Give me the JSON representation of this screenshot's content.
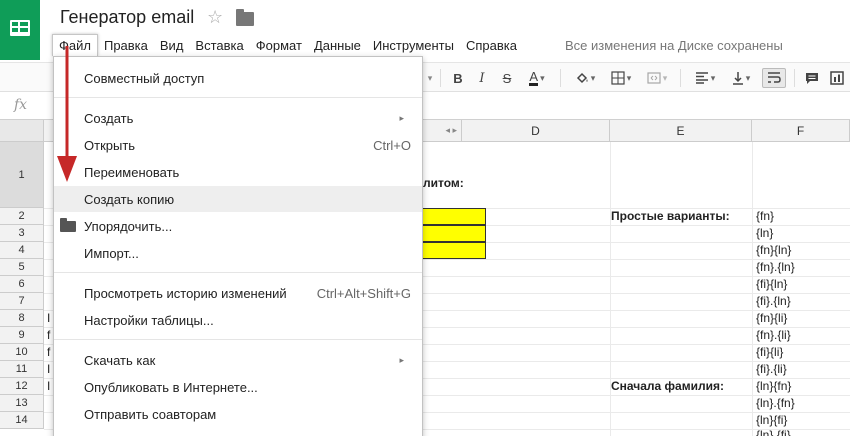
{
  "header": {
    "title": "Генератор email",
    "save_status": "Все изменения на Диске сохранены"
  },
  "menubar": [
    "Файл",
    "Правка",
    "Вид",
    "Вставка",
    "Формат",
    "Данные",
    "Инструменты",
    "Справка"
  ],
  "formula_bar": {
    "fx_label": "fx"
  },
  "columns": [
    "D",
    "E",
    "F"
  ],
  "rows": [
    "1",
    "2",
    "3",
    "4",
    "5",
    "6",
    "7",
    "8",
    "9",
    "10",
    "11",
    "12",
    "13",
    "14"
  ],
  "sheet": {
    "row1_fragment": "литом:",
    "simple_label": "Простые варианты:",
    "surname_first_label": "Сначала фамилия:",
    "left_fragments": [
      "I",
      "f",
      "f",
      "I",
      "I"
    ],
    "f_values": [
      "{fn}",
      "{ln}",
      "{fn}{ln}",
      "{fn}.{ln}",
      "{fi}{ln}",
      "{fi}.{ln}",
      "{fn}{li}",
      "{fn}.{li}",
      "{fi}{li}",
      "{fi}.{li}",
      "{ln}{fn}",
      "{ln}.{fn}",
      "{ln}{fi}",
      "{ln}.{fi}"
    ]
  },
  "file_menu": {
    "items": [
      {
        "label": "Совместный доступ",
        "shortcut": ""
      },
      {
        "label": "Создать",
        "shortcut": "",
        "submenu": true
      },
      {
        "label": "Открыть",
        "shortcut": "Ctrl+O"
      },
      {
        "label": "Переименовать",
        "shortcut": ""
      },
      {
        "label": "Создать копию",
        "shortcut": ""
      },
      {
        "label": "Упорядочить...",
        "shortcut": ""
      },
      {
        "label": "Импорт...",
        "shortcut": ""
      },
      {
        "label": "Просмотреть историю изменений",
        "shortcut": "Ctrl+Alt+Shift+G"
      },
      {
        "label": "Настройки таблицы...",
        "shortcut": ""
      },
      {
        "label": "Скачать как",
        "shortcut": "",
        "submenu": true
      },
      {
        "label": "Опубликовать в Интернете...",
        "shortcut": ""
      },
      {
        "label": "Отправить соавторам",
        "shortcut": ""
      }
    ],
    "highlighted": "Создать копию"
  },
  "colors": {
    "brand": "#0f9d58",
    "annotation_arrow": "#c62828",
    "highlight_cell": "#ffff00"
  },
  "icons": [
    "star-icon",
    "folder-icon",
    "bold-icon",
    "italic-icon",
    "strikethrough-icon",
    "text-color-icon",
    "fill-color-icon",
    "borders-icon",
    "merge-cells-icon",
    "align-left-icon",
    "valign-bottom-icon",
    "wrap-text-icon",
    "comment-icon",
    "insert-chart-icon",
    "fx-icon"
  ]
}
